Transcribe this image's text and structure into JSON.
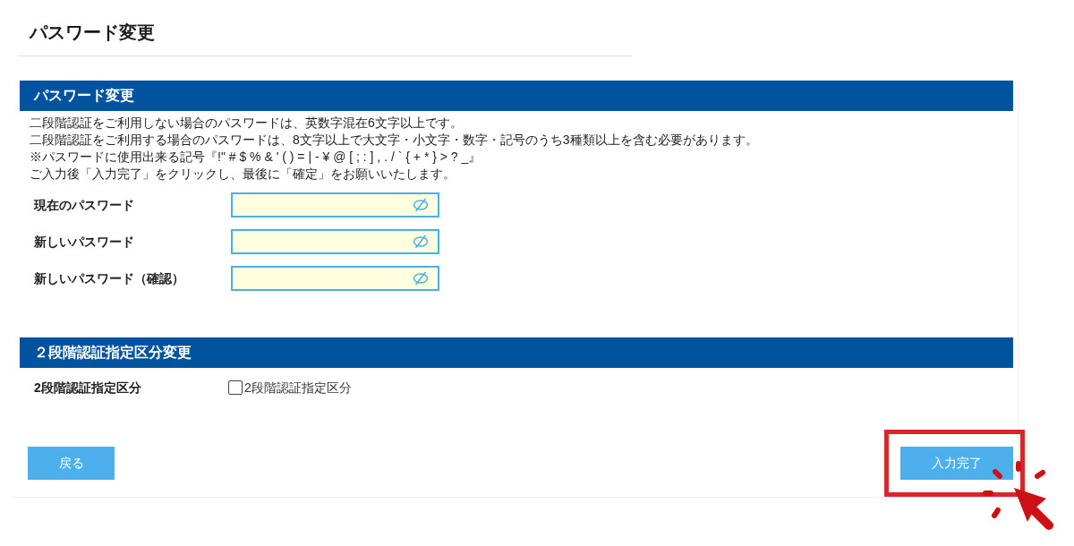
{
  "page_title": "パスワード変更",
  "sections": [
    {
      "kind": "password",
      "title": "パスワード変更",
      "notes": [
        "二段階認証をご利用しない場合のパスワードは、英数字混在6文字以上です。",
        "二段階認証をご利用する場合のパスワードは、8文字以上で大文字・小文字・数字・記号のうち3種類以上を含む必要があります。",
        "※パスワードに使用出来る記号『!\" # $ % & ' ( ) = | - ¥ @ [ ; : ] , . / ` { + * } > ? _』",
        "ご入力後「入力完了」をクリックし、最後に「確定」をお願いいたします。"
      ],
      "fields": [
        {
          "label": "現在のパスワード"
        },
        {
          "label": "新しいパスワード"
        },
        {
          "label": "新しいパスワード（確認）"
        }
      ]
    },
    {
      "kind": "checkbox",
      "title": "２段階認証指定区分変更",
      "rows": [
        {
          "label": "2段階認証指定区分",
          "checkbox_label": "2段階認証指定区分",
          "checked": false
        }
      ]
    }
  ],
  "buttons": [
    {
      "label": "戻る",
      "highlighted": false
    },
    {
      "label": "入力完了",
      "highlighted": true
    }
  ]
}
